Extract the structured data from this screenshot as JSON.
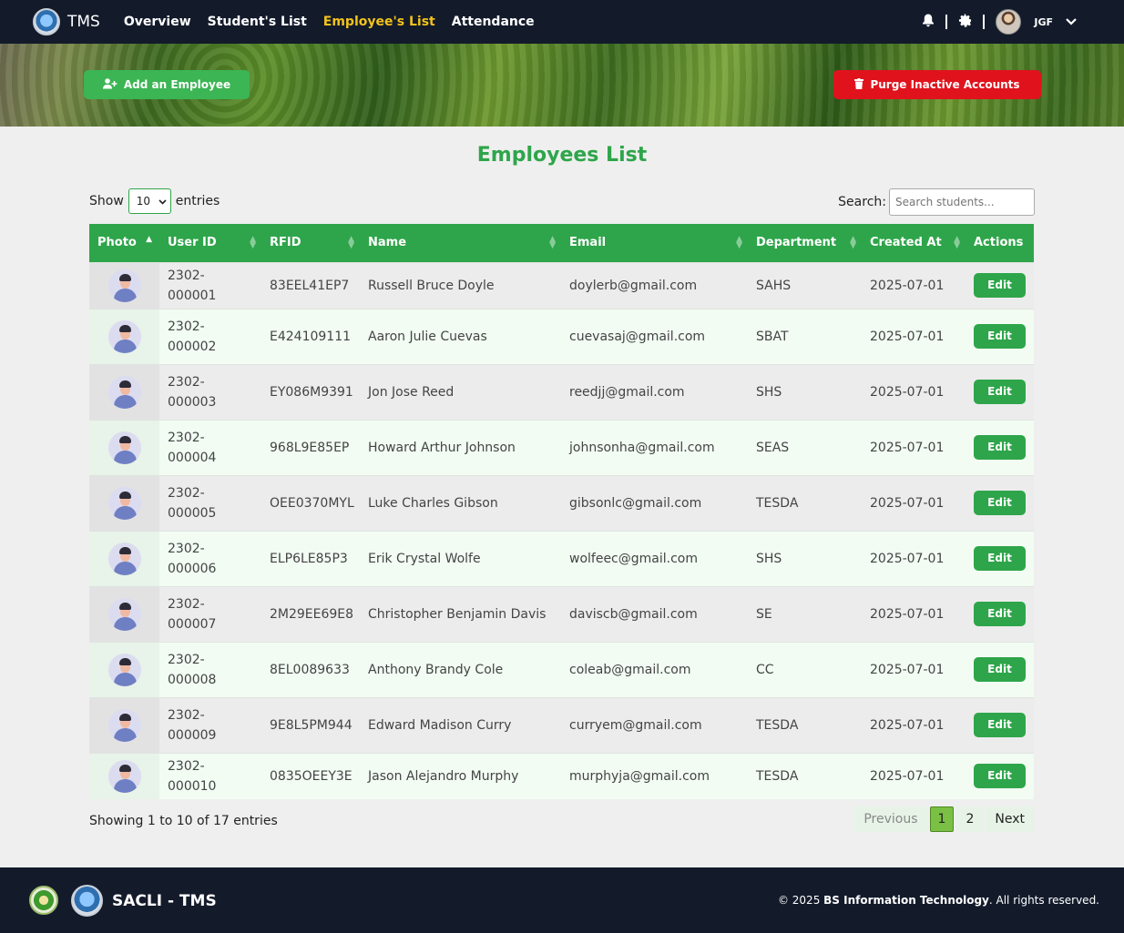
{
  "nav": {
    "brand": "TMS",
    "links": [
      "Overview",
      "Student's List",
      "Employee's List",
      "Attendance"
    ],
    "user": "JGF"
  },
  "banner": {
    "add_label": "Add an Employee",
    "purge_label": "Purge Inactive Accounts"
  },
  "page": {
    "title": "Employees List",
    "show_label": "Show",
    "entries_value": "10",
    "entries_label": "entries",
    "search_label": "Search:",
    "search_placeholder": "Search students..."
  },
  "table": {
    "headers": [
      "Photo",
      "User ID",
      "RFID",
      "Name",
      "Email",
      "Department",
      "Created At",
      "Actions"
    ],
    "edit_label": "Edit",
    "rows": [
      {
        "user_id": "2302-000001",
        "rfid": "83EEL41EP7",
        "name": "Russell Bruce Doyle",
        "email": "doylerb@gmail.com",
        "dept": "SAHS",
        "created": "2025-07-01"
      },
      {
        "user_id": "2302-000002",
        "rfid": "E424109111",
        "name": "Aaron Julie Cuevas",
        "email": "cuevasaj@gmail.com",
        "dept": "SBAT",
        "created": "2025-07-01"
      },
      {
        "user_id": "2302-000003",
        "rfid": "EY086M9391",
        "name": "Jon Jose Reed",
        "email": "reedjj@gmail.com",
        "dept": "SHS",
        "created": "2025-07-01"
      },
      {
        "user_id": "2302-000004",
        "rfid": "968L9E85EP",
        "name": "Howard Arthur Johnson",
        "email": "johnsonha@gmail.com",
        "dept": "SEAS",
        "created": "2025-07-01"
      },
      {
        "user_id": "2302-000005",
        "rfid": "OEE0370MYL",
        "name": "Luke Charles Gibson",
        "email": "gibsonlc@gmail.com",
        "dept": "TESDA",
        "created": "2025-07-01"
      },
      {
        "user_id": "2302-000006",
        "rfid": "ELP6LE85P3",
        "name": "Erik Crystal Wolfe",
        "email": "wolfeec@gmail.com",
        "dept": "SHS",
        "created": "2025-07-01"
      },
      {
        "user_id": "2302-000007",
        "rfid": "2M29EE69E8",
        "name": "Christopher Benjamin Davis",
        "email": "daviscb@gmail.com",
        "dept": "SE",
        "created": "2025-07-01"
      },
      {
        "user_id": "2302-000008",
        "rfid": "8EL0089633",
        "name": "Anthony Brandy Cole",
        "email": "coleab@gmail.com",
        "dept": "CC",
        "created": "2025-07-01"
      },
      {
        "user_id": "2302-000009",
        "rfid": "9E8L5PM944",
        "name": "Edward Madison Curry",
        "email": "curryem@gmail.com",
        "dept": "TESDA",
        "created": "2025-07-01"
      },
      {
        "user_id": "2302-000010",
        "rfid": "0835OEEY3E",
        "name": "Jason Alejandro Murphy",
        "email": "murphyja@gmail.com",
        "dept": "TESDA",
        "created": "2025-07-01"
      }
    ]
  },
  "pagination": {
    "info": "Showing 1 to 10 of 17 entries",
    "previous": "Previous",
    "pages": [
      "1",
      "2"
    ],
    "current_page": "1",
    "next": "Next"
  },
  "footer": {
    "title": "SACLI - TMS",
    "copy_prefix": "© 2025",
    "copy_bold": "BS Information Technology",
    "copy_suffix": ". All rights reserved."
  },
  "colors": {
    "navbar": "#131b2b",
    "accent_green": "#2ea54a",
    "active_nav": "#f2c21b",
    "danger": "#e0131d"
  },
  "icons": [
    "bell-icon",
    "gear-icon",
    "user-plus-icon",
    "trash-icon",
    "chevron-down-icon",
    "sort-icon"
  ]
}
